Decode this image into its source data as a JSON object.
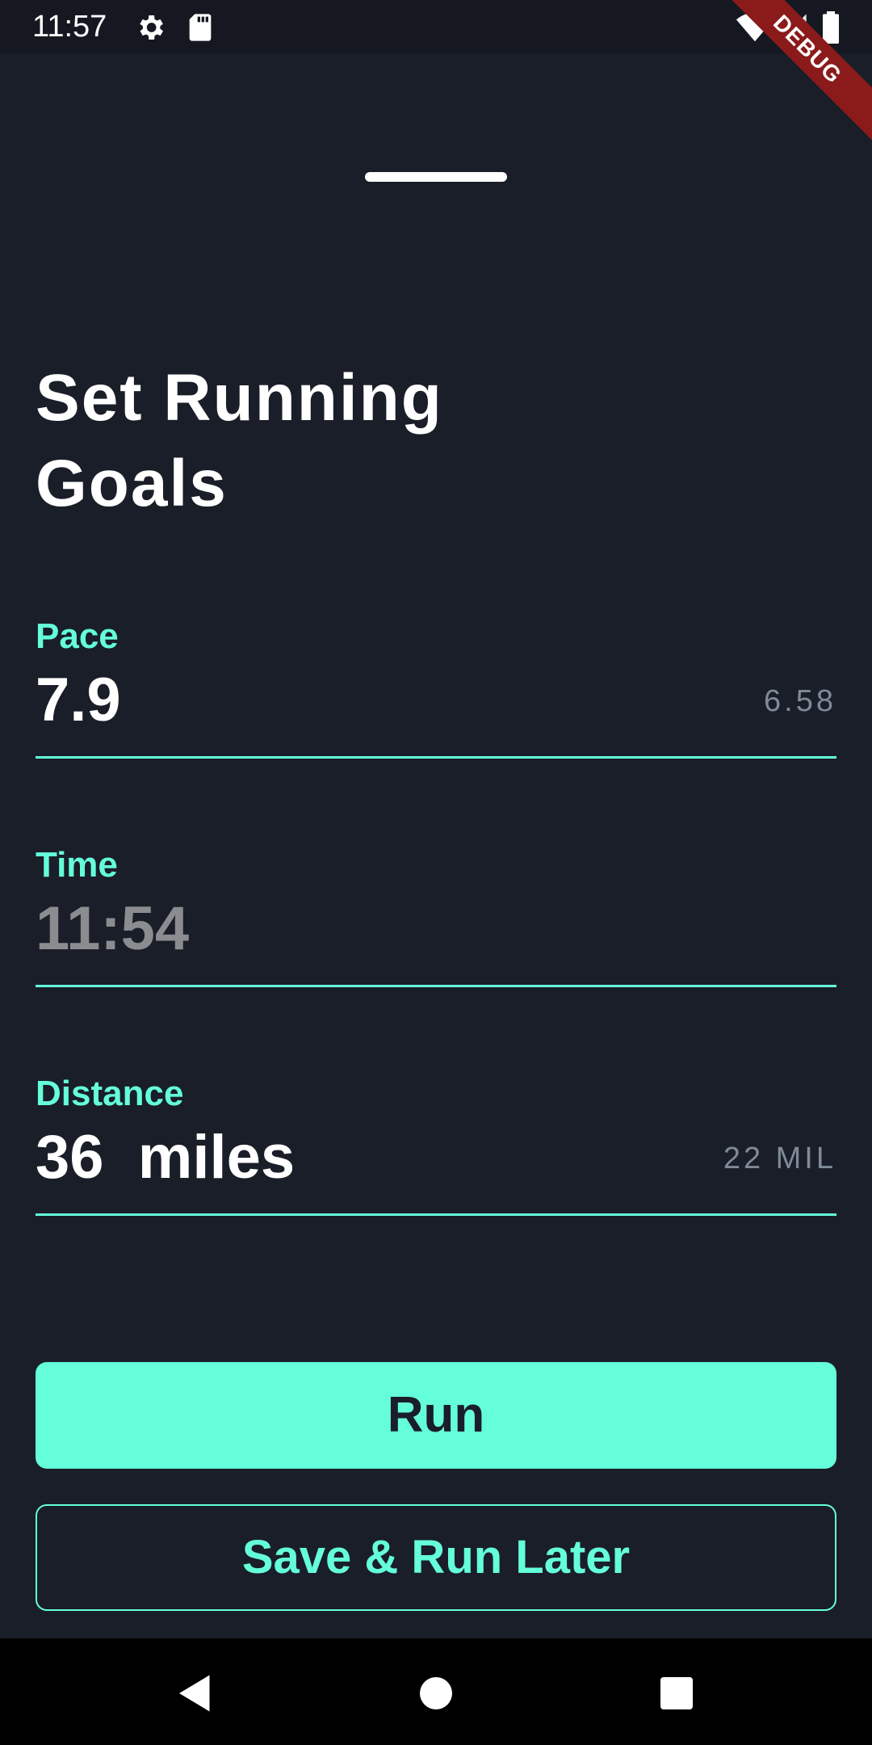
{
  "status_bar": {
    "time": "11:57",
    "icons": [
      "settings-icon",
      "sd-card-icon",
      "wifi-icon",
      "signal-icon",
      "battery-icon"
    ],
    "debug_label": "DEBUG"
  },
  "title": "Set Running Goals",
  "fields": [
    {
      "label": "Pace",
      "value": "7.9",
      "suffix": "6.58"
    },
    {
      "label": "Time",
      "value": "11:54",
      "suffix": ""
    },
    {
      "label": "Distance",
      "value": "36  miles",
      "suffix": "22 MIL"
    }
  ],
  "buttons": {
    "run_label": "Run",
    "save_label": "Save & Run Later"
  },
  "nav": {
    "icons": [
      "back-icon",
      "home-icon",
      "recents-icon"
    ]
  },
  "colors": {
    "background": "#1a1e28",
    "accent": "#64ffda",
    "muted_value": "#8a8c90",
    "debug_banner": "#8b1a1a"
  }
}
